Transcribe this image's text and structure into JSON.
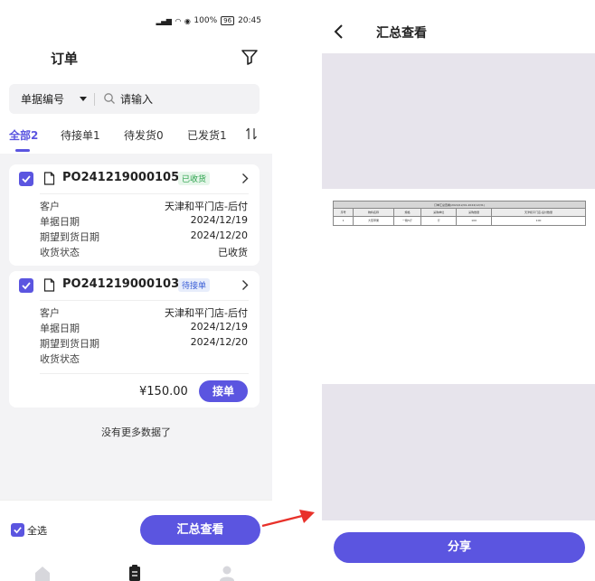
{
  "status_bar": {
    "left_text": "",
    "battery": "100%",
    "battery_badge": "96",
    "time": "20:45"
  },
  "left": {
    "header_title": "订单",
    "search": {
      "type_label": "单据编号",
      "placeholder": "请输入"
    },
    "tabs": [
      {
        "label": "全部2",
        "active": true
      },
      {
        "label": "待接单1",
        "active": false
      },
      {
        "label": "待发货0",
        "active": false
      },
      {
        "label": "已发货1",
        "active": false
      }
    ],
    "orders": [
      {
        "number": "PO241219000105",
        "status_badge": "已收货",
        "fields": [
          {
            "key": "客户",
            "value": "天津和平门店-后付"
          },
          {
            "key": "单据日期",
            "value": "2024/12/19"
          },
          {
            "key": "期望到货日期",
            "value": "2024/12/20"
          },
          {
            "key": "收货状态",
            "value": "已收货"
          }
        ]
      },
      {
        "number": "PO241219000103",
        "status_badge": "待接单",
        "fields": [
          {
            "key": "客户",
            "value": "天津和平门店-后付"
          },
          {
            "key": "单据日期",
            "value": "2024/12/19"
          },
          {
            "key": "期望到货日期",
            "value": "2024/12/20"
          },
          {
            "key": "收货状态",
            "value": ""
          }
        ],
        "price": "¥150.00",
        "accept_label": "接单"
      }
    ],
    "no_more_text": "没有更多数据了",
    "select_all_label": "全选",
    "summary_button_label": "汇总查看"
  },
  "right": {
    "title": "汇总查看",
    "sheet": {
      "caption": "订单汇总查看(2024/12/01-2024/12/31)",
      "headers": [
        "序号",
        "物料名称",
        "规格",
        "采购单位",
        "采购数量",
        "天津和平门店-后付数量"
      ],
      "row": [
        "1",
        "大葱苹果",
        "一箱5斤",
        "斤",
        "100",
        "100"
      ]
    },
    "share_label": "分享"
  },
  "colors": {
    "accent": "#5b55e0",
    "badge_green": "#2aa24b",
    "badge_blue": "#3b5fd6",
    "arrow_red": "#e8312a"
  }
}
